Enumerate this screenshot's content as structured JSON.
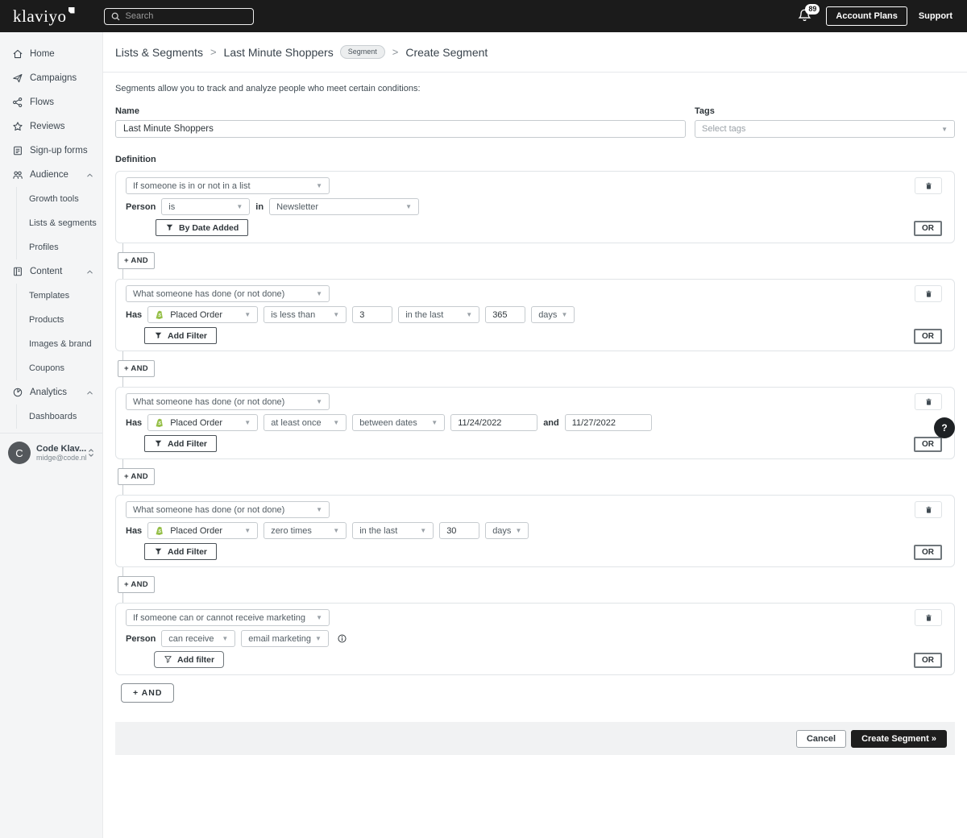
{
  "topbar": {
    "logo": "klaviyo",
    "search_placeholder": "Search",
    "notification_count": "89",
    "account_plans_label": "Account Plans",
    "support_label": "Support"
  },
  "sidebar": {
    "items": [
      {
        "label": "Home",
        "icon": "home-icon"
      },
      {
        "label": "Campaigns",
        "icon": "send-icon"
      },
      {
        "label": "Flows",
        "icon": "flows-icon"
      },
      {
        "label": "Reviews",
        "icon": "star-icon"
      },
      {
        "label": "Sign-up forms",
        "icon": "form-icon"
      },
      {
        "label": "Audience",
        "icon": "people-icon"
      },
      {
        "label": "Growth tools"
      },
      {
        "label": "Lists & segments"
      },
      {
        "label": "Profiles"
      },
      {
        "label": "Content",
        "icon": "book-icon"
      },
      {
        "label": "Templates"
      },
      {
        "label": "Products"
      },
      {
        "label": "Images & brand"
      },
      {
        "label": "Coupons"
      },
      {
        "label": "Analytics",
        "icon": "pie-icon"
      },
      {
        "label": "Dashboards"
      }
    ],
    "user": {
      "initial": "C",
      "name": "Code Klav...",
      "email": "midge@code.nl"
    }
  },
  "breadcrumb": {
    "part1": "Lists & Segments",
    "part2": "Last Minute Shoppers",
    "badge": "Segment",
    "part3": "Create Segment",
    "separator": ">"
  },
  "page": {
    "intro": "Segments allow you to track and analyze people who meet certain conditions:",
    "name_label": "Name",
    "name_value": "Last Minute Shoppers",
    "tags_label": "Tags",
    "tags_placeholder": "Select tags",
    "definition_label": "Definition",
    "and_connector": "+ AND",
    "and_final": "+ AND"
  },
  "blocks": {
    "b1": {
      "type": "If someone is in or not in a list",
      "person_label": "Person",
      "op": "is",
      "conj": "in",
      "list": "Newsletter",
      "filter_label": "By Date Added",
      "or_label": "OR"
    },
    "b2": {
      "type": "What someone has done (or not done)",
      "has_label": "Has",
      "metric": "Placed Order",
      "op": "is less than",
      "count": "3",
      "range": "in the last",
      "range_value": "365",
      "unit": "days",
      "filter_label": "Add Filter",
      "or_label": "OR"
    },
    "b3": {
      "type": "What someone has done (or not done)",
      "has_label": "Has",
      "metric": "Placed Order",
      "op": "at least once",
      "range": "between dates",
      "date_start": "11/24/2022",
      "and_label": "and",
      "date_end": "11/27/2022",
      "filter_label": "Add Filter",
      "or_label": "OR"
    },
    "b4": {
      "type": "What someone has done (or not done)",
      "has_label": "Has",
      "metric": "Placed Order",
      "op": "zero times",
      "range": "in the last",
      "range_value": "30",
      "unit": "days",
      "filter_label": "Add Filter",
      "or_label": "OR"
    },
    "b5": {
      "type": "If someone can or cannot receive marketing",
      "person_label": "Person",
      "op": "can receive",
      "channel": "email marketing",
      "filter_label": "Add filter",
      "or_label": "OR"
    }
  },
  "footer": {
    "cancel_label": "Cancel",
    "create_label": "Create Segment »"
  },
  "help_label": "?",
  "colors": {
    "topbar": "#1b1b1b",
    "sidebar_bg": "#f4f5f6",
    "shopify_green": "#95bf47",
    "primary_button": "#1e1e1e"
  }
}
